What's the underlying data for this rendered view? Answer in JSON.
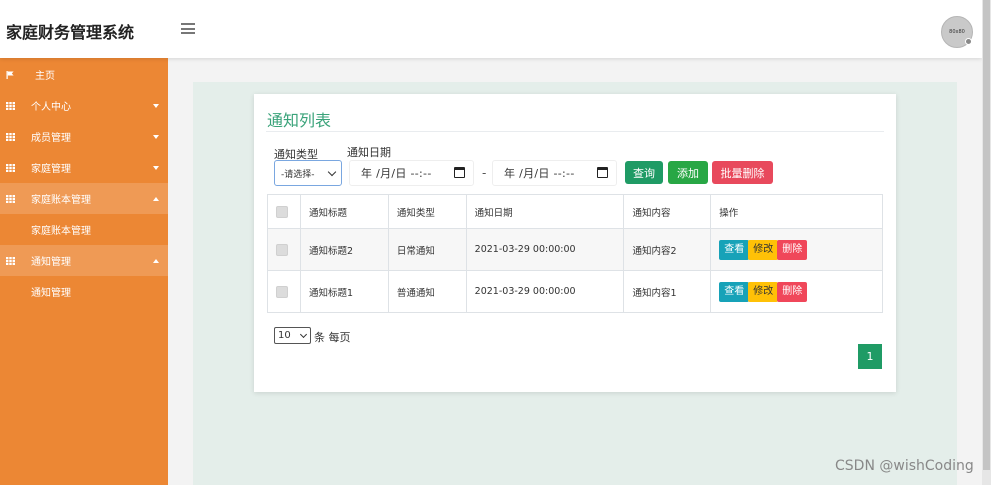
{
  "app": {
    "title": "家庭财务管理系统",
    "avatar_text": "80x80"
  },
  "sidebar": {
    "items": [
      {
        "label": "主页"
      },
      {
        "label": "个人中心"
      },
      {
        "label": "成员管理"
      },
      {
        "label": "家庭管理"
      },
      {
        "label": "家庭账本管理"
      },
      {
        "label": "家庭账本管理"
      },
      {
        "label": "通知管理"
      },
      {
        "label": "通知管理"
      }
    ]
  },
  "card": {
    "title": "通知列表"
  },
  "filters": {
    "type_label": "通知类型",
    "date_label": "通知日期",
    "type_value": "-请选择-",
    "date_start": "年 /月/日 --:--",
    "date_end": "年 /月/日 --:--",
    "dash": "-"
  },
  "toolbar": {
    "query": "查询",
    "add": "添加",
    "batch_delete": "批量删除"
  },
  "table": {
    "headers": [
      "通知标题",
      "通知类型",
      "通知日期",
      "通知内容",
      "操作"
    ],
    "rows": [
      {
        "title": "通知标题2",
        "type": "日常通知",
        "date": "2021-03-29 00:00:00",
        "content": "通知内容2"
      },
      {
        "title": "通知标题1",
        "type": "普通通知",
        "date": "2021-03-29 00:00:00",
        "content": "通知内容1"
      }
    ],
    "actions": {
      "view": "查看",
      "edit": "修改",
      "delete": "删除"
    }
  },
  "pagination": {
    "page_size": "10",
    "page_size_suffix": "条 每页",
    "current_page": "1"
  },
  "watermark": "CSDN @wishCoding",
  "colors": {
    "sidebar": "#ec8734",
    "accent": "#1f9b65",
    "title": "#3aa37a",
    "danger": "#e8495c"
  }
}
